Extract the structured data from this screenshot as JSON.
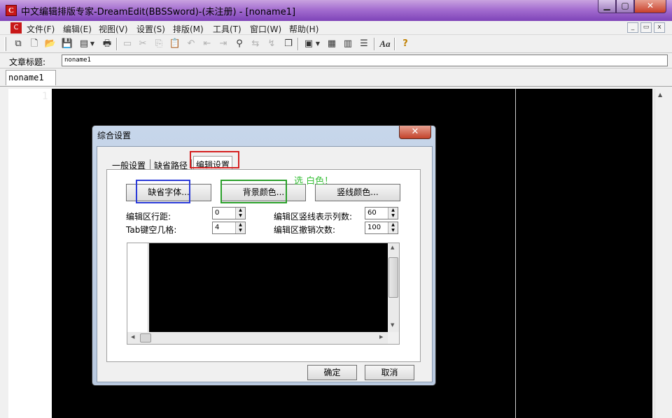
{
  "window": {
    "title": "中文编辑排版专家-DreamEdit(BBSSword)-(未注册) - [noname1]",
    "icon": "app-logo-icon"
  },
  "menu": [
    "文件(F)",
    "编辑(E)",
    "视图(V)",
    "设置(S)",
    "排版(M)",
    "工具(T)",
    "窗口(W)",
    "帮助(H)"
  ],
  "toolbar": {
    "icons": [
      "copy-windows-icon",
      "new-file-icon",
      "open-folder-icon",
      "save-icon",
      "template-icon",
      "print-icon",
      "page-icon",
      "cut-icon",
      "copy-icon",
      "paste-icon",
      "undo-icon",
      "indent-icon",
      "outdent-icon",
      "find-icon",
      "replace-icon",
      "find-next-icon",
      "clipboard-icon",
      "view-icon",
      "layout-icon",
      "columns-icon",
      "list-icon",
      "font-icon",
      "help-icon"
    ],
    "font_glyph": "Aa",
    "help_glyph": "?"
  },
  "article": {
    "label": "文章标题:",
    "value": "noname1"
  },
  "doc_tab": "noname1",
  "editor": {
    "line_number": "1",
    "background": "#000000"
  },
  "dialog": {
    "title": "综合设置",
    "close": "✕",
    "tabs": [
      "一般设置",
      "缺省路径",
      "编辑设置"
    ],
    "active_tab": "编辑设置",
    "buttons": {
      "default_font": "缺省字体...",
      "bg_color": "背景颜色...",
      "vline_color": "竖线颜色..."
    },
    "fields": {
      "line_spacing_label": "编辑区行距:",
      "line_spacing_value": "0",
      "tab_label": "Tab键空几格:",
      "tab_value": "4",
      "vline_col_label": "编辑区竖线表示列数:",
      "vline_col_value": "60",
      "undo_label": "编辑区撤销次数:",
      "undo_value": "100"
    },
    "ok": "确定",
    "cancel": "取消"
  },
  "annotation": {
    "note": "选 白色！",
    "colors": {
      "red": "#d42020",
      "blue": "#2a3ad8",
      "green": "#2aa02a"
    }
  }
}
